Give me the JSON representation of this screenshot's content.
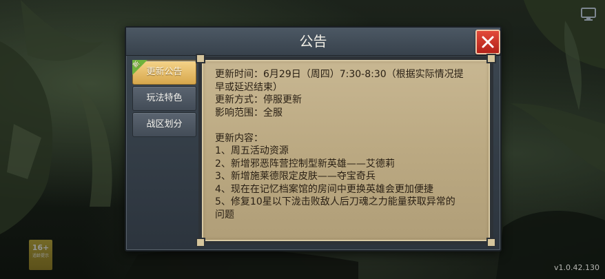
{
  "dialog": {
    "title": "公告",
    "close_icon": "close-x-icon"
  },
  "tabs": [
    {
      "label": "更新公告",
      "active": true,
      "badge": "新"
    },
    {
      "label": "玩法特色",
      "active": false
    },
    {
      "label": "战区划分",
      "active": false
    }
  ],
  "announcement": {
    "lines": [
      "更新时间：6月29日（周四）7:30-8:30（根据实际情况提",
      "早或延迟结束）",
      "更新方式：停服更新",
      "影响范围：全服",
      "",
      "更新内容：",
      "1、周五活动资源",
      "2、新增邪恶阵营控制型新英雄——艾德莉",
      "3、新增施莱德限定皮肤——夺宝奇兵",
      "4、现在在记忆档案馆的房间中更换英雄会更加便捷",
      "5、修复10星以下泷击败敌人后刀魂之力能量获取异常的",
      "问题"
    ]
  },
  "age_rating": {
    "number": "16+",
    "caption": "适龄提示"
  },
  "version": "v1.0.42.130",
  "top_right_icon": "monitor-icon",
  "colors": {
    "active_tab": "#e2b462",
    "close_button": "#c8302a",
    "panel_parchment": "#bfae88",
    "new_badge": "#6fb33c"
  }
}
